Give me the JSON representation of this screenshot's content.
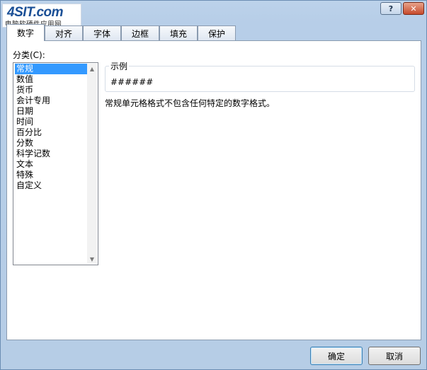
{
  "window": {
    "help_label": "?",
    "close_label": "✕"
  },
  "logo": {
    "brand": "4SIT.com",
    "subtitle": "电脑软硬件应用网"
  },
  "tabs": [
    {
      "label": "数字",
      "active": true
    },
    {
      "label": "对齐",
      "active": false
    },
    {
      "label": "字体",
      "active": false
    },
    {
      "label": "边框",
      "active": false
    },
    {
      "label": "填充",
      "active": false
    },
    {
      "label": "保护",
      "active": false
    }
  ],
  "category": {
    "label": "分类(C):",
    "items": [
      "常规",
      "数值",
      "货币",
      "会计专用",
      "日期",
      "时间",
      "百分比",
      "分数",
      "科学记数",
      "文本",
      "特殊",
      "自定义"
    ],
    "selected": "常规"
  },
  "sample": {
    "label": "示例",
    "value": "######"
  },
  "description": "常规单元格格式不包含任何特定的数字格式。",
  "buttons": {
    "ok": "确定",
    "cancel": "取消"
  },
  "icons": {
    "scroll_up": "scroll-up-arrow-icon",
    "scroll_down": "scroll-down-arrow-icon"
  }
}
